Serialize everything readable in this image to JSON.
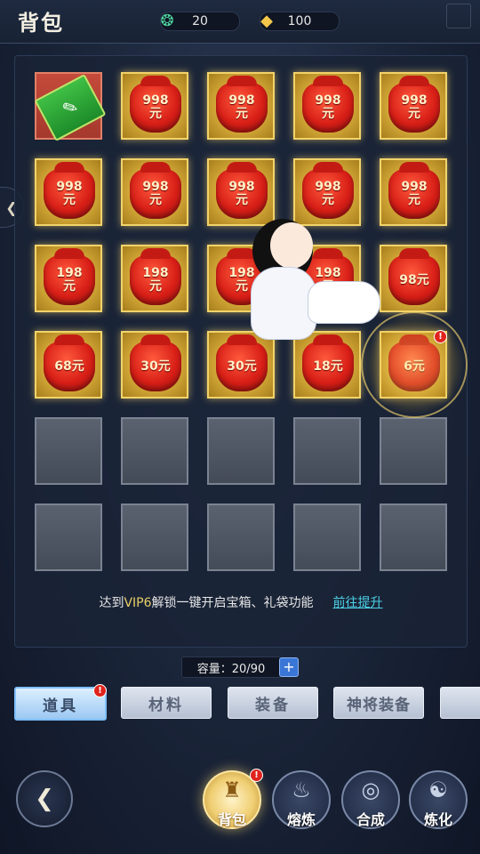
{
  "header": {
    "title": "背包",
    "jade": "20",
    "gold": "100"
  },
  "slots": [
    {
      "type": "ticket",
      "label": ""
    },
    {
      "type": "bag",
      "label": "998\n元"
    },
    {
      "type": "bag",
      "label": "998\n元"
    },
    {
      "type": "bag",
      "label": "998\n元"
    },
    {
      "type": "bag",
      "label": "998\n元"
    },
    {
      "type": "bag",
      "label": "998\n元"
    },
    {
      "type": "bag",
      "label": "998\n元"
    },
    {
      "type": "bag",
      "label": "998\n元"
    },
    {
      "type": "bag",
      "label": "998\n元"
    },
    {
      "type": "bag",
      "label": "998\n元"
    },
    {
      "type": "bag",
      "label": "198\n元"
    },
    {
      "type": "bag",
      "label": "198\n元"
    },
    {
      "type": "bag",
      "label": "198\n元"
    },
    {
      "type": "bag",
      "label": "198\n元"
    },
    {
      "type": "bag",
      "label": "98元"
    },
    {
      "type": "bag",
      "label": "68元"
    },
    {
      "type": "bag",
      "label": "30元"
    },
    {
      "type": "bag",
      "label": "30元"
    },
    {
      "type": "bag",
      "label": "18元"
    },
    {
      "type": "bag",
      "label": "6元"
    },
    {
      "type": "empty",
      "label": ""
    },
    {
      "type": "empty",
      "label": ""
    },
    {
      "type": "empty",
      "label": ""
    },
    {
      "type": "empty",
      "label": ""
    },
    {
      "type": "empty",
      "label": ""
    },
    {
      "type": "empty",
      "label": ""
    },
    {
      "type": "empty",
      "label": ""
    },
    {
      "type": "empty",
      "label": ""
    },
    {
      "type": "empty",
      "label": ""
    },
    {
      "type": "empty",
      "label": ""
    }
  ],
  "badge_mark": "!",
  "notice": {
    "pre": "达到",
    "vip": "VIP6",
    "post": "解锁一键开启宝箱、礼袋功能",
    "link": "前往提升"
  },
  "capacity": {
    "text": "容量：20/90",
    "add": "+"
  },
  "tabs": [
    {
      "label": "道具",
      "active": true
    },
    {
      "label": "材料",
      "active": false
    },
    {
      "label": "装备",
      "active": false
    },
    {
      "label": "神将装备",
      "active": false
    }
  ],
  "nav": [
    {
      "label": "背包",
      "active": true
    },
    {
      "label": "熔炼",
      "active": false
    },
    {
      "label": "合成",
      "active": false
    },
    {
      "label": "炼化",
      "active": false
    }
  ],
  "colors": {
    "gold_slot": "#d3a838",
    "bag_red": "#d81f17",
    "link": "#4cd0e6",
    "vip": "#e8d064"
  }
}
